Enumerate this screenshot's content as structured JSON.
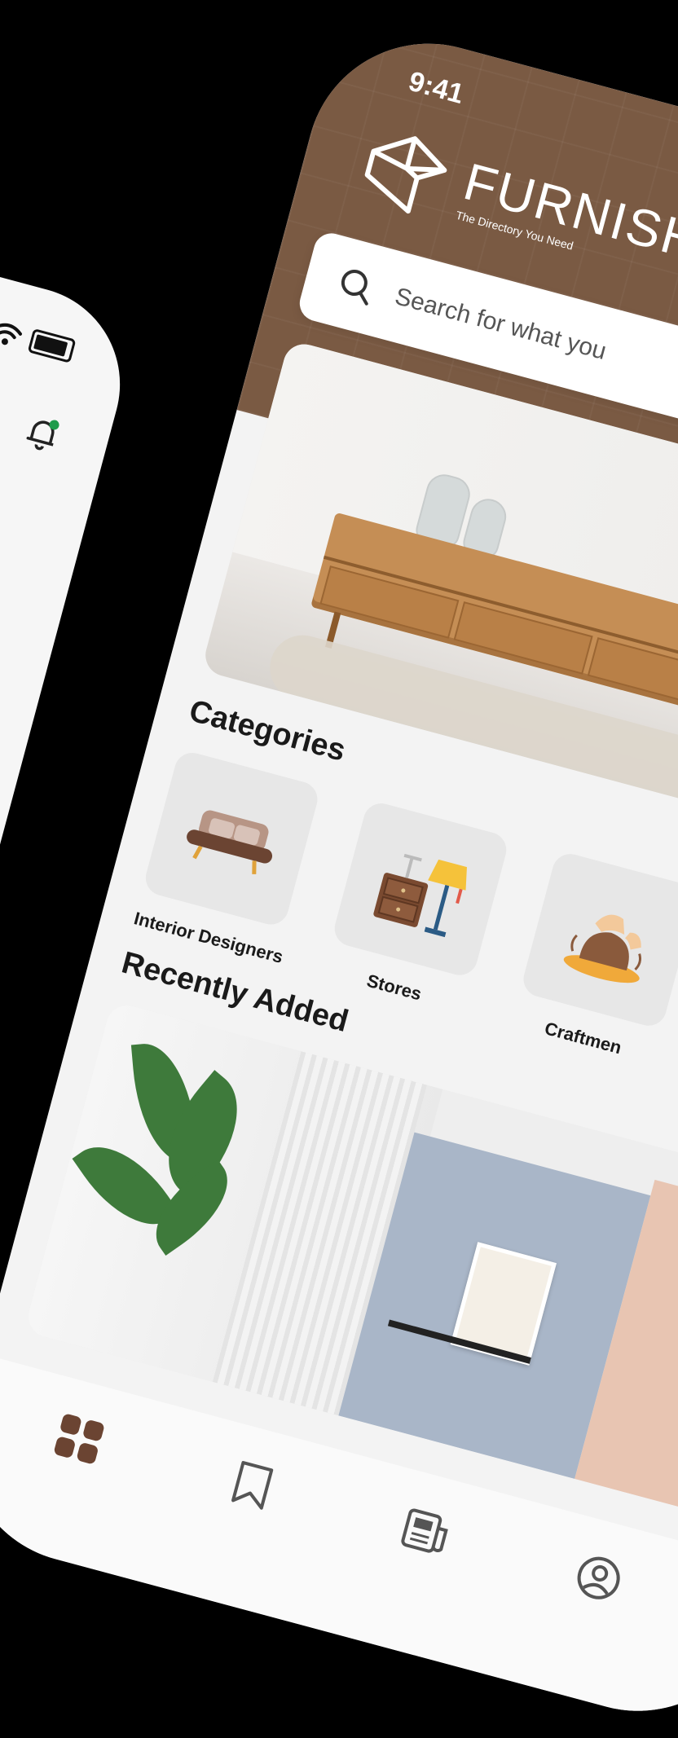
{
  "back_phone": {
    "status_icons": [
      "signal-icon",
      "wifi-icon",
      "battery-icon"
    ],
    "notification_icon": "bell-icon"
  },
  "status_bar": {
    "time": "9:41"
  },
  "brand": {
    "name": "FURNISH",
    "tagline": "The Directory You Need",
    "color": "#7a5a43"
  },
  "search": {
    "placeholder": "Search for what you"
  },
  "categories": {
    "title": "Categories",
    "items": [
      {
        "label": "Interior Designers",
        "icon": "sofa-icon"
      },
      {
        "label": "Stores",
        "icon": "nightstand-lamp-icon"
      },
      {
        "label": "Craftmen",
        "icon": "pottery-icon"
      }
    ]
  },
  "recent": {
    "title": "Recently Added"
  },
  "bottom_nav": {
    "items": [
      {
        "icon": "grid-icon",
        "active": true
      },
      {
        "icon": "bookmark-icon",
        "active": false
      },
      {
        "icon": "news-icon",
        "active": false
      },
      {
        "icon": "profile-icon",
        "active": false
      }
    ]
  }
}
